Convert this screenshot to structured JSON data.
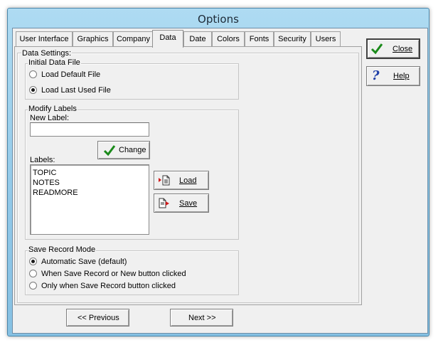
{
  "window": {
    "title": "Options"
  },
  "tabs": [
    {
      "label": "User Interface"
    },
    {
      "label": "Graphics"
    },
    {
      "label": "Company"
    },
    {
      "label": "Data"
    },
    {
      "label": "Date"
    },
    {
      "label": "Colors"
    },
    {
      "label": "Fonts"
    },
    {
      "label": "Security"
    },
    {
      "label": "Users"
    }
  ],
  "active_tab": "Data",
  "data_settings": {
    "label": "Data Settings:",
    "initial_data_file": {
      "label": "Initial Data File",
      "options": [
        "Load Default File",
        "Load Last Used File"
      ],
      "selected": "Load Last Used File"
    },
    "modify_labels": {
      "label": "Modify Labels",
      "new_label_caption": "New Label:",
      "new_label_value": "",
      "change_button": "Change",
      "labels_caption": "Labels:",
      "labels": [
        "TOPIC",
        "NOTES",
        "READMORE"
      ],
      "load_button": "Load",
      "save_button": "Save"
    }
  },
  "save_record_mode": {
    "label": "Save Record Mode",
    "options": [
      "Automatic Save (default)",
      "When Save Record or New button clicked",
      "Only when Save Record button clicked"
    ],
    "selected": "Automatic Save (default)"
  },
  "side_buttons": {
    "close": "Close",
    "help": "Help"
  },
  "nav": {
    "previous": "<< Previous",
    "next": "Next >>"
  },
  "colors": {
    "check_green": "#1a8a1a",
    "help_blue": "#1f3fa8",
    "title_bar": "#9bd0ee"
  }
}
